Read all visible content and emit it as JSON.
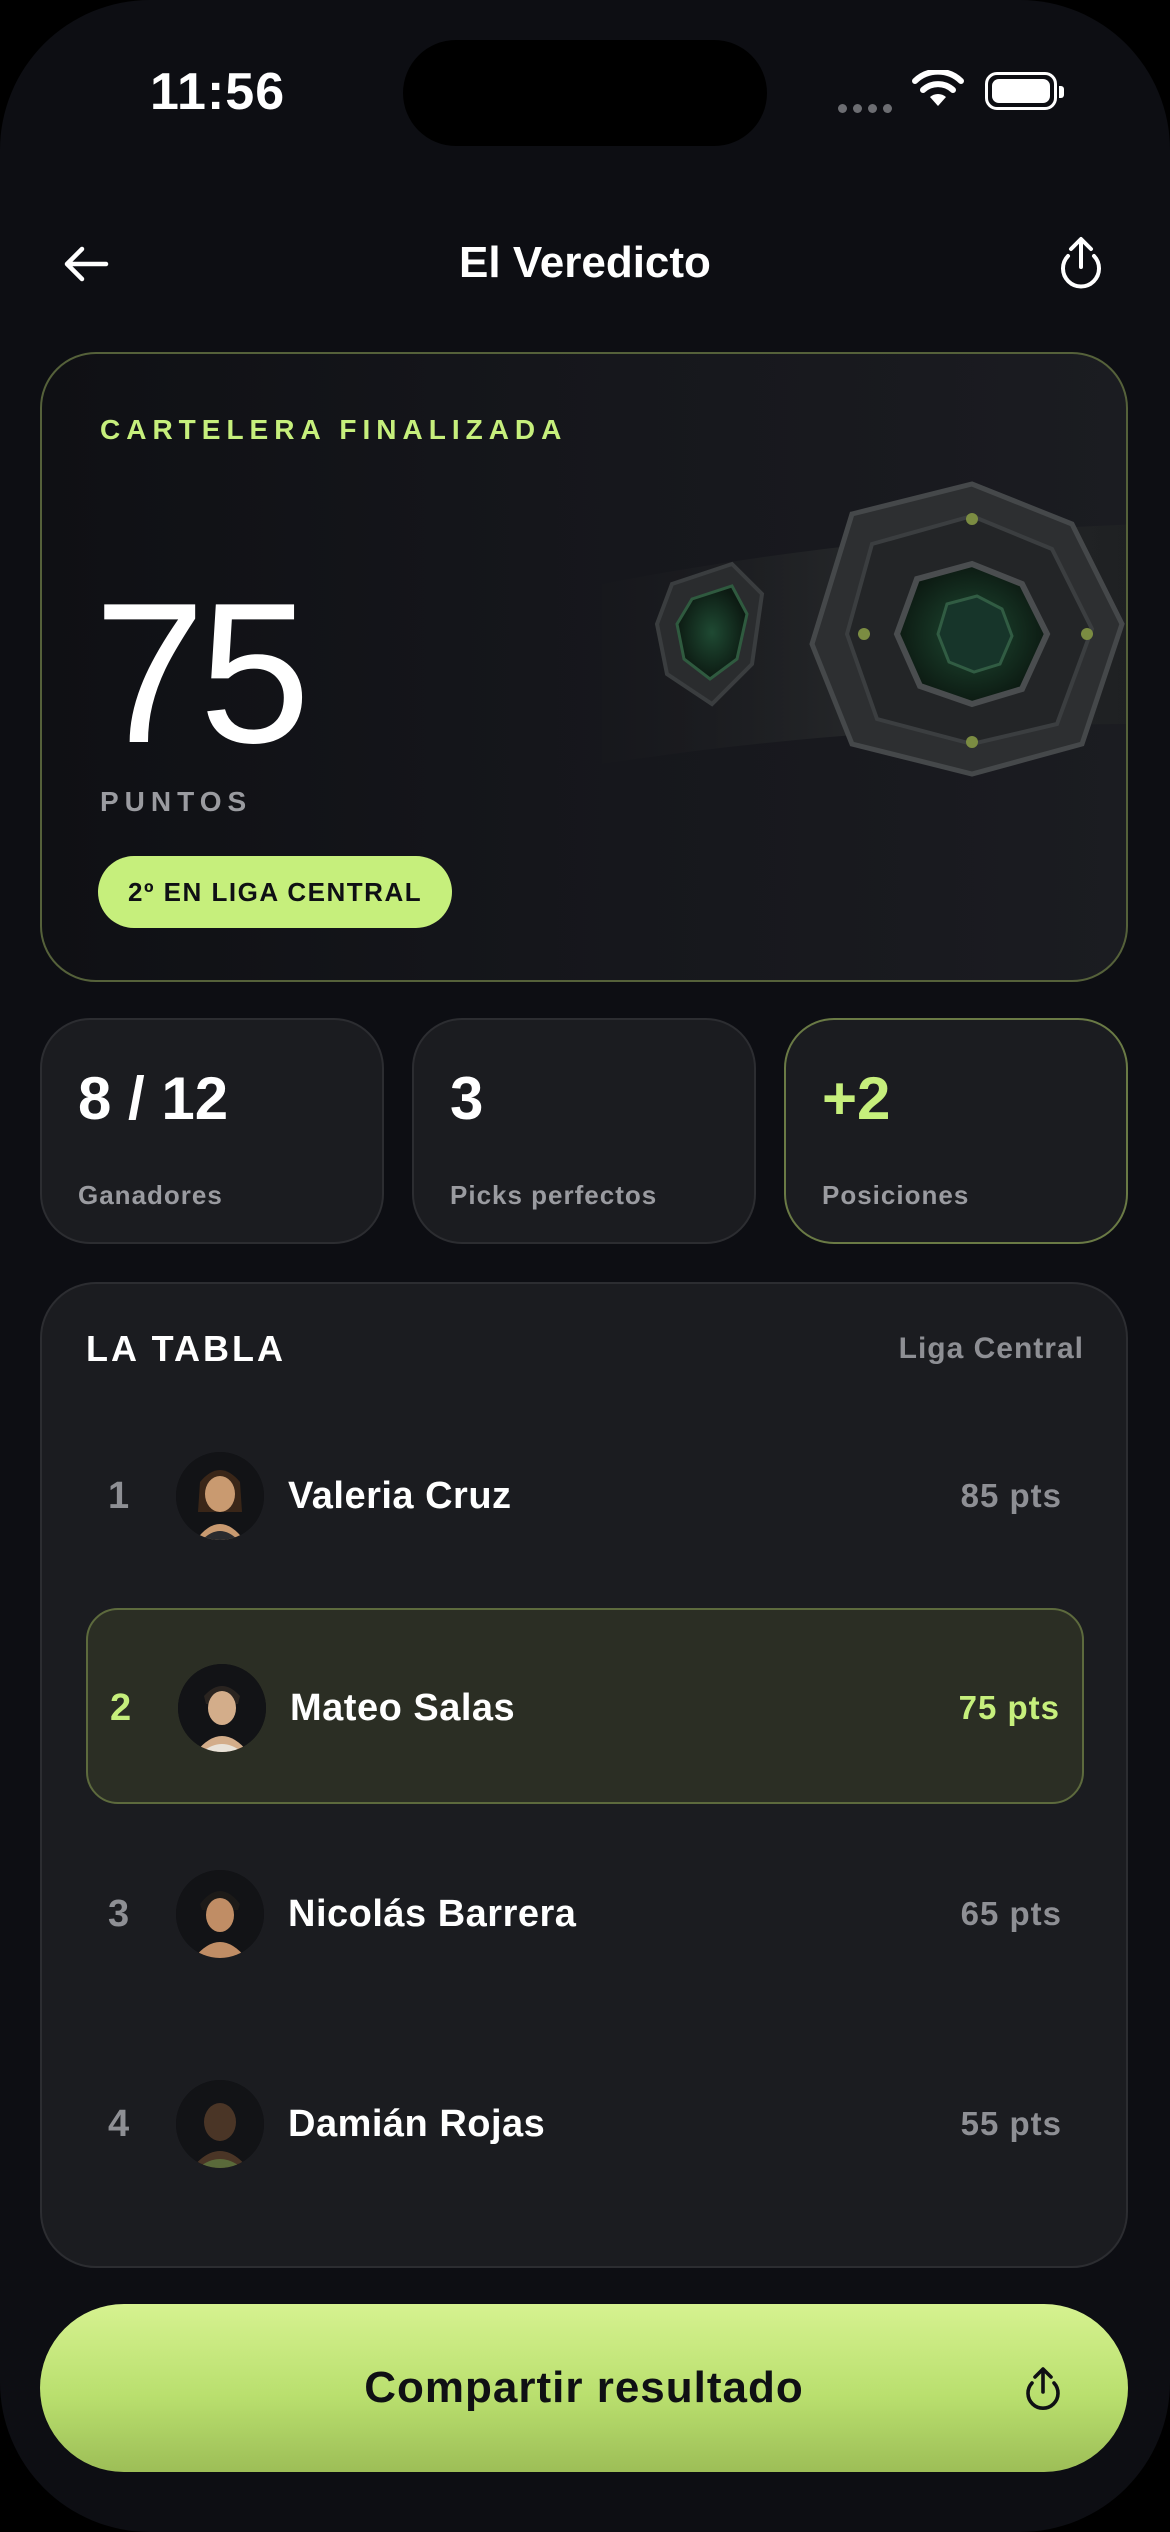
{
  "status_bar": {
    "time": "11:56"
  },
  "nav": {
    "title": "El Veredicto"
  },
  "hero": {
    "eyebrow": "CARTELERA FINALIZADA",
    "score": "75",
    "score_unit": "PUNTOS",
    "rank_pill": "2º EN LIGA CENTRAL"
  },
  "stats": [
    {
      "value": "8 / 12",
      "label": "Ganadores"
    },
    {
      "value": "3",
      "label": "Picks perfectos"
    },
    {
      "value": "+2",
      "label": "Posiciones"
    }
  ],
  "standings": {
    "title": "LA TABLA",
    "league": "Liga Central",
    "rows": [
      {
        "rank": "1",
        "name": "Valeria Cruz",
        "points": "85 pts"
      },
      {
        "rank": "2",
        "name": "Mateo Salas",
        "points": "75 pts"
      },
      {
        "rank": "3",
        "name": "Nicolás Barrera",
        "points": "65 pts"
      },
      {
        "rank": "4",
        "name": "Damián Rojas",
        "points": "55 pts"
      }
    ]
  },
  "cta": {
    "label": "Compartir resultado"
  },
  "colors": {
    "accent": "#c6ef7c",
    "background": "#0d0e13",
    "card": "#1b1c20"
  }
}
